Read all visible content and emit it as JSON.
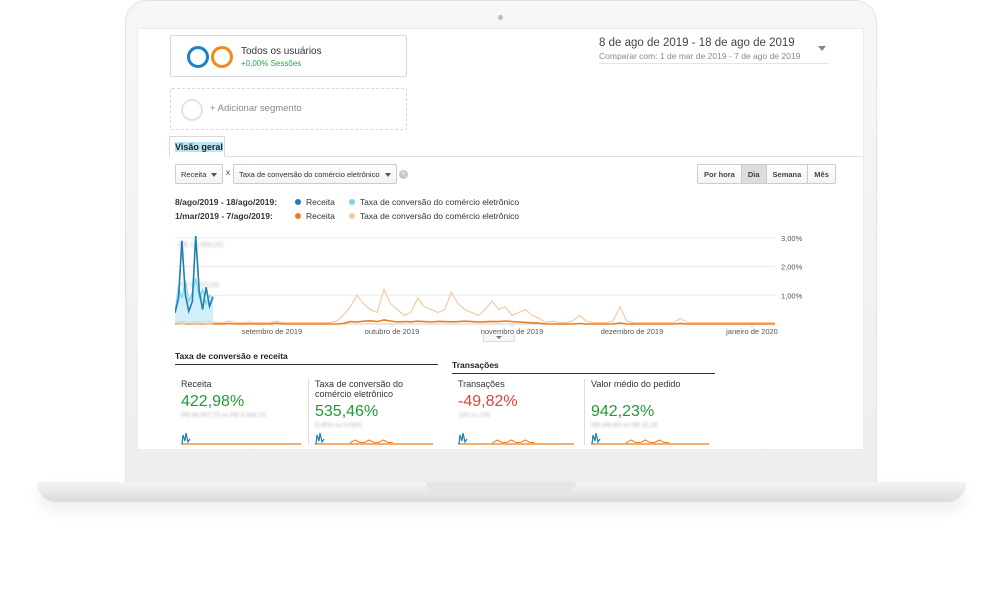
{
  "segments": {
    "primary": {
      "title": "Todos os usuários",
      "subtitle": "+0,00% Sessões"
    },
    "add_label": "+ Adicionar segmento"
  },
  "date_range": {
    "main": "8 de ago de 2019 - 18 de ago de 2019",
    "compare": "Comparar com: 1 de mar de 2019 - 7 de ago de 2019"
  },
  "tabs": {
    "overview": "Visão geral"
  },
  "selectors": {
    "metric1": "Receita",
    "times": "x",
    "metric2": "Taxa de conversão do comércio eletrônico"
  },
  "period_buttons": [
    {
      "label": "Por hora",
      "active": false
    },
    {
      "label": "Dia",
      "active": true
    },
    {
      "label": "Semana",
      "active": false
    },
    {
      "label": "Mês",
      "active": false
    }
  ],
  "legend": [
    {
      "range": "8/ago/2019 - 18/ago/2019:",
      "items": [
        {
          "label": "Receita",
          "color": "#1a7fb5"
        },
        {
          "label": "Taxa de conversão do comércio eletrônico",
          "color": "#7fd3ee"
        }
      ]
    },
    {
      "range": "1/mar/2019 - 7/ago/2019:",
      "items": [
        {
          "label": "Receita",
          "color": "#f07d1a"
        },
        {
          "label": "Taxa de conversão do comércio eletrônico",
          "color": "#f7c9a2"
        }
      ]
    }
  ],
  "chart_data": {
    "type": "line",
    "x_tick_labels": [
      "setembro de 2019",
      "outubro de 2019",
      "novembro de 2019",
      "dezembro de 2019",
      "janeiro de 2020"
    ],
    "y2_tick_labels": [
      "1,00%",
      "2,00%",
      "3,00%"
    ],
    "y2_ticks": [
      1,
      2,
      3
    ],
    "y2lim": [
      0,
      3.2
    ],
    "y1_tick_labels": [
      "R$ 5.000,00",
      "R$ 10.000,00"
    ],
    "y1_ticks": [
      5000,
      10000
    ],
    "y1lim": [
      0,
      11500
    ],
    "series": [
      {
        "name": "Receita",
        "period": "8/ago/2019 - 18/ago/2019",
        "color": "#1a7fb5",
        "axis": "y1",
        "values": [
          1400,
          3200,
          10400,
          3600,
          1600,
          2800,
          11000,
          4200,
          1800,
          4600,
          2200,
          3400
        ]
      },
      {
        "name": "Taxa de conversão do comércio eletrônico",
        "period": "8/ago/2019 - 18/ago/2019",
        "color": "#7fd3ee",
        "axis": "y2",
        "values": [
          0.4,
          1.3,
          0.9,
          1.5,
          0.8,
          1.1,
          1.6,
          0.9,
          1.2,
          0.7,
          1.0,
          0.9
        ]
      },
      {
        "name": "Receita",
        "period": "1/mar/2019 - 7/ago/2019",
        "color": "#f07d1a",
        "axis": "y1",
        "values": [
          0,
          100,
          0,
          50,
          0,
          60,
          0,
          0,
          80,
          0,
          0,
          40,
          0,
          0,
          0,
          100,
          0,
          0,
          0,
          0,
          0,
          0,
          0,
          0,
          0,
          80,
          300,
          250,
          350,
          400,
          300,
          500,
          380,
          250,
          300,
          280,
          350,
          300,
          250,
          320,
          300,
          280,
          300,
          350,
          300,
          250,
          280,
          320,
          300,
          380,
          300,
          250,
          200,
          150,
          100,
          0,
          0,
          0,
          0,
          0,
          60,
          0,
          0,
          0,
          0,
          0,
          120,
          0,
          0,
          0,
          0,
          0,
          0,
          0,
          0,
          80,
          0,
          0,
          0,
          0,
          0,
          0,
          0,
          0,
          0,
          0,
          0,
          0,
          0,
          0
        ]
      },
      {
        "name": "Taxa de conversão do comércio eletrônico",
        "period": "1/mar/2019 - 7/ago/2019",
        "color": "#f7c9a2",
        "axis": "y2",
        "values": [
          0.05,
          0.1,
          0.05,
          0.08,
          0.05,
          0.1,
          0.05,
          0.05,
          0.1,
          0.05,
          0.05,
          0.08,
          0.05,
          0.05,
          0.05,
          0.1,
          0.05,
          0.05,
          0.05,
          0.05,
          0.05,
          0.05,
          0.05,
          0.05,
          0.1,
          0.3,
          0.6,
          1.0,
          0.7,
          0.5,
          0.4,
          1.2,
          0.7,
          0.5,
          0.3,
          0.4,
          0.9,
          0.6,
          0.5,
          0.4,
          0.5,
          1.1,
          0.7,
          0.5,
          0.4,
          0.3,
          0.5,
          0.8,
          0.5,
          0.6,
          0.3,
          0.4,
          0.5,
          0.3,
          0.2,
          0.05,
          0.1,
          0.05,
          0.05,
          0.1,
          0.3,
          0.1,
          0.05,
          0.05,
          0.05,
          0.1,
          0.6,
          0.1,
          0.05,
          0.05,
          0.05,
          0.05,
          0.05,
          0.05,
          0.05,
          0.2,
          0.05,
          0.05,
          0.05,
          0.05,
          0.05,
          0.05,
          0.05,
          0.05,
          0.05,
          0.05,
          0.05,
          0.05,
          0.05,
          0.05
        ]
      }
    ]
  },
  "sections": {
    "conversion": {
      "title": "Taxa de conversão e receita",
      "metrics": [
        {
          "label": "Receita",
          "value": "422,98%",
          "trend": "up",
          "sub": "R$ 48.597,73 vs R$ 9.284,74"
        },
        {
          "label": "Taxa de conversão do comércio eletrônico",
          "value": "535,46%",
          "trend": "up",
          "sub": "0,35% vs 0,06%"
        }
      ]
    },
    "transactions": {
      "title": "Transações",
      "metrics": [
        {
          "label": "Transações",
          "value": "-49,82%",
          "trend": "down",
          "sub": "140 vs 279"
        },
        {
          "label": "Valor médio do pedido",
          "value": "942,23%",
          "trend": "up",
          "sub": "R$ 346,84 vs R$ 33,28"
        }
      ]
    }
  }
}
